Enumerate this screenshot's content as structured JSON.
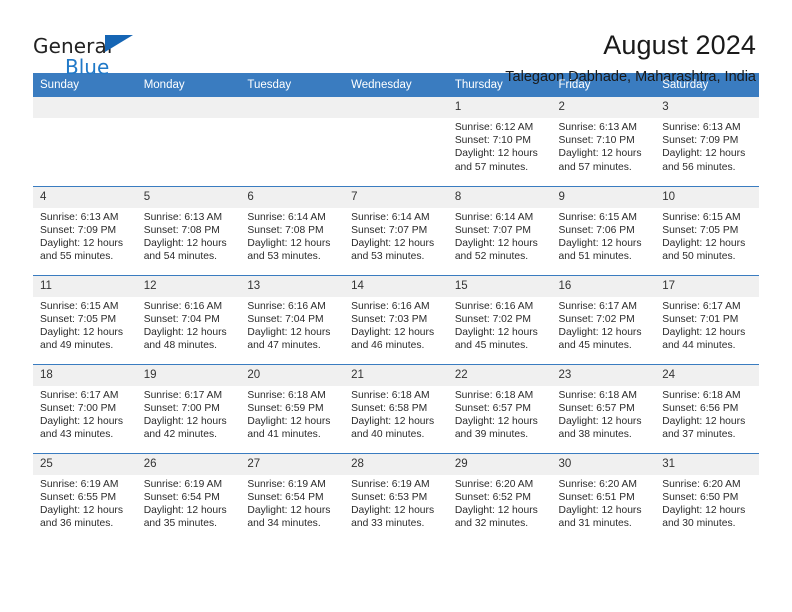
{
  "brand": {
    "line1": "General",
    "line2": "Blue",
    "triangle_color": "#1565b4",
    "blue_text_color": "#2079c8"
  },
  "header": {
    "title": "August 2024",
    "subtitle": "Talegaon Dabhade, Maharashtra, India"
  },
  "theme": {
    "header_bg": "#3a7cc0",
    "daynum_bg": "#f0f0f0",
    "grid_line": "#3a7cc0",
    "text": "#2b2b2b"
  },
  "weekday_headers": [
    "Sunday",
    "Monday",
    "Tuesday",
    "Wednesday",
    "Thursday",
    "Friday",
    "Saturday"
  ],
  "weeks": [
    [
      {
        "day": "",
        "blank": true
      },
      {
        "day": "",
        "blank": true
      },
      {
        "day": "",
        "blank": true
      },
      {
        "day": "",
        "blank": true
      },
      {
        "day": "1",
        "sunrise": "Sunrise: 6:12 AM",
        "sunset": "Sunset: 7:10 PM",
        "daylight_1": "Daylight: 12 hours",
        "daylight_2": "and 57 minutes."
      },
      {
        "day": "2",
        "sunrise": "Sunrise: 6:13 AM",
        "sunset": "Sunset: 7:10 PM",
        "daylight_1": "Daylight: 12 hours",
        "daylight_2": "and 57 minutes."
      },
      {
        "day": "3",
        "sunrise": "Sunrise: 6:13 AM",
        "sunset": "Sunset: 7:09 PM",
        "daylight_1": "Daylight: 12 hours",
        "daylight_2": "and 56 minutes."
      }
    ],
    [
      {
        "day": "4",
        "sunrise": "Sunrise: 6:13 AM",
        "sunset": "Sunset: 7:09 PM",
        "daylight_1": "Daylight: 12 hours",
        "daylight_2": "and 55 minutes."
      },
      {
        "day": "5",
        "sunrise": "Sunrise: 6:13 AM",
        "sunset": "Sunset: 7:08 PM",
        "daylight_1": "Daylight: 12 hours",
        "daylight_2": "and 54 minutes."
      },
      {
        "day": "6",
        "sunrise": "Sunrise: 6:14 AM",
        "sunset": "Sunset: 7:08 PM",
        "daylight_1": "Daylight: 12 hours",
        "daylight_2": "and 53 minutes."
      },
      {
        "day": "7",
        "sunrise": "Sunrise: 6:14 AM",
        "sunset": "Sunset: 7:07 PM",
        "daylight_1": "Daylight: 12 hours",
        "daylight_2": "and 53 minutes."
      },
      {
        "day": "8",
        "sunrise": "Sunrise: 6:14 AM",
        "sunset": "Sunset: 7:07 PM",
        "daylight_1": "Daylight: 12 hours",
        "daylight_2": "and 52 minutes."
      },
      {
        "day": "9",
        "sunrise": "Sunrise: 6:15 AM",
        "sunset": "Sunset: 7:06 PM",
        "daylight_1": "Daylight: 12 hours",
        "daylight_2": "and 51 minutes."
      },
      {
        "day": "10",
        "sunrise": "Sunrise: 6:15 AM",
        "sunset": "Sunset: 7:05 PM",
        "daylight_1": "Daylight: 12 hours",
        "daylight_2": "and 50 minutes."
      }
    ],
    [
      {
        "day": "11",
        "sunrise": "Sunrise: 6:15 AM",
        "sunset": "Sunset: 7:05 PM",
        "daylight_1": "Daylight: 12 hours",
        "daylight_2": "and 49 minutes."
      },
      {
        "day": "12",
        "sunrise": "Sunrise: 6:16 AM",
        "sunset": "Sunset: 7:04 PM",
        "daylight_1": "Daylight: 12 hours",
        "daylight_2": "and 48 minutes."
      },
      {
        "day": "13",
        "sunrise": "Sunrise: 6:16 AM",
        "sunset": "Sunset: 7:04 PM",
        "daylight_1": "Daylight: 12 hours",
        "daylight_2": "and 47 minutes."
      },
      {
        "day": "14",
        "sunrise": "Sunrise: 6:16 AM",
        "sunset": "Sunset: 7:03 PM",
        "daylight_1": "Daylight: 12 hours",
        "daylight_2": "and 46 minutes."
      },
      {
        "day": "15",
        "sunrise": "Sunrise: 6:16 AM",
        "sunset": "Sunset: 7:02 PM",
        "daylight_1": "Daylight: 12 hours",
        "daylight_2": "and 45 minutes."
      },
      {
        "day": "16",
        "sunrise": "Sunrise: 6:17 AM",
        "sunset": "Sunset: 7:02 PM",
        "daylight_1": "Daylight: 12 hours",
        "daylight_2": "and 45 minutes."
      },
      {
        "day": "17",
        "sunrise": "Sunrise: 6:17 AM",
        "sunset": "Sunset: 7:01 PM",
        "daylight_1": "Daylight: 12 hours",
        "daylight_2": "and 44 minutes."
      }
    ],
    [
      {
        "day": "18",
        "sunrise": "Sunrise: 6:17 AM",
        "sunset": "Sunset: 7:00 PM",
        "daylight_1": "Daylight: 12 hours",
        "daylight_2": "and 43 minutes."
      },
      {
        "day": "19",
        "sunrise": "Sunrise: 6:17 AM",
        "sunset": "Sunset: 7:00 PM",
        "daylight_1": "Daylight: 12 hours",
        "daylight_2": "and 42 minutes."
      },
      {
        "day": "20",
        "sunrise": "Sunrise: 6:18 AM",
        "sunset": "Sunset: 6:59 PM",
        "daylight_1": "Daylight: 12 hours",
        "daylight_2": "and 41 minutes."
      },
      {
        "day": "21",
        "sunrise": "Sunrise: 6:18 AM",
        "sunset": "Sunset: 6:58 PM",
        "daylight_1": "Daylight: 12 hours",
        "daylight_2": "and 40 minutes."
      },
      {
        "day": "22",
        "sunrise": "Sunrise: 6:18 AM",
        "sunset": "Sunset: 6:57 PM",
        "daylight_1": "Daylight: 12 hours",
        "daylight_2": "and 39 minutes."
      },
      {
        "day": "23",
        "sunrise": "Sunrise: 6:18 AM",
        "sunset": "Sunset: 6:57 PM",
        "daylight_1": "Daylight: 12 hours",
        "daylight_2": "and 38 minutes."
      },
      {
        "day": "24",
        "sunrise": "Sunrise: 6:18 AM",
        "sunset": "Sunset: 6:56 PM",
        "daylight_1": "Daylight: 12 hours",
        "daylight_2": "and 37 minutes."
      }
    ],
    [
      {
        "day": "25",
        "sunrise": "Sunrise: 6:19 AM",
        "sunset": "Sunset: 6:55 PM",
        "daylight_1": "Daylight: 12 hours",
        "daylight_2": "and 36 minutes."
      },
      {
        "day": "26",
        "sunrise": "Sunrise: 6:19 AM",
        "sunset": "Sunset: 6:54 PM",
        "daylight_1": "Daylight: 12 hours",
        "daylight_2": "and 35 minutes."
      },
      {
        "day": "27",
        "sunrise": "Sunrise: 6:19 AM",
        "sunset": "Sunset: 6:54 PM",
        "daylight_1": "Daylight: 12 hours",
        "daylight_2": "and 34 minutes."
      },
      {
        "day": "28",
        "sunrise": "Sunrise: 6:19 AM",
        "sunset": "Sunset: 6:53 PM",
        "daylight_1": "Daylight: 12 hours",
        "daylight_2": "and 33 minutes."
      },
      {
        "day": "29",
        "sunrise": "Sunrise: 6:20 AM",
        "sunset": "Sunset: 6:52 PM",
        "daylight_1": "Daylight: 12 hours",
        "daylight_2": "and 32 minutes."
      },
      {
        "day": "30",
        "sunrise": "Sunrise: 6:20 AM",
        "sunset": "Sunset: 6:51 PM",
        "daylight_1": "Daylight: 12 hours",
        "daylight_2": "and 31 minutes."
      },
      {
        "day": "31",
        "sunrise": "Sunrise: 6:20 AM",
        "sunset": "Sunset: 6:50 PM",
        "daylight_1": "Daylight: 12 hours",
        "daylight_2": "and 30 minutes."
      }
    ]
  ]
}
